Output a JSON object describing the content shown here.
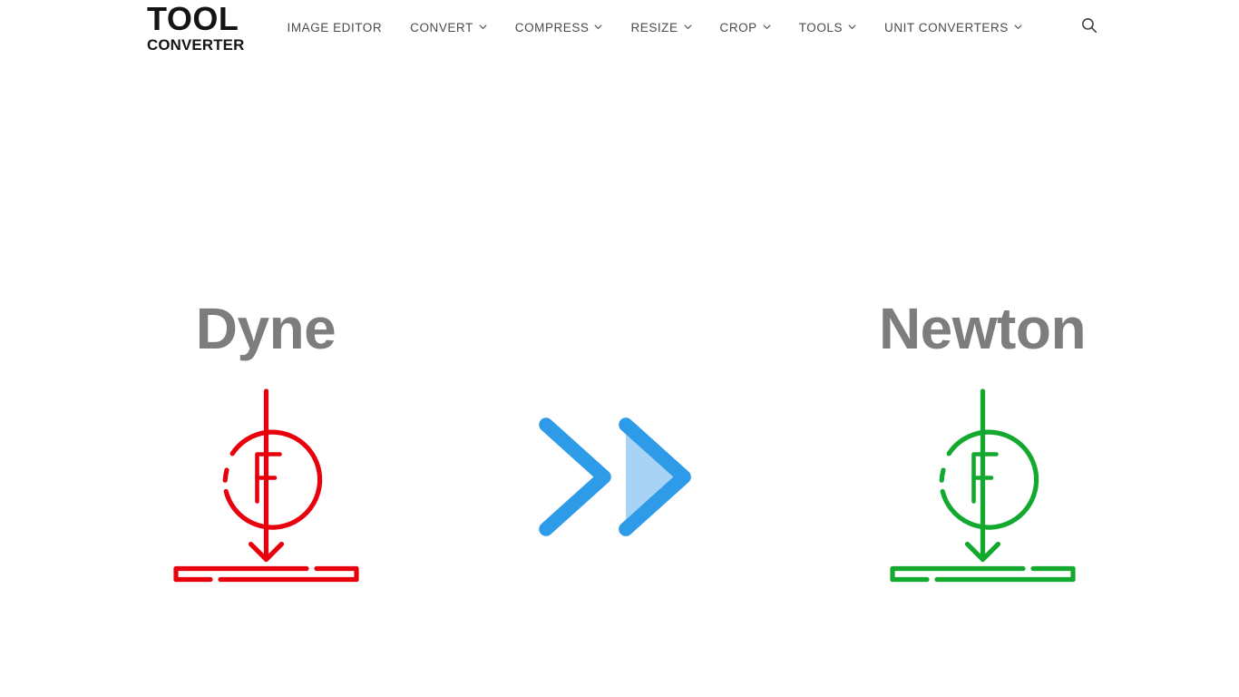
{
  "site": {
    "logo_top": "TOOL",
    "logo_bottom": "CONVERTER"
  },
  "nav": {
    "items": [
      {
        "label": "IMAGE EDITOR",
        "has_dropdown": false
      },
      {
        "label": "CONVERT",
        "has_dropdown": true
      },
      {
        "label": "COMPRESS",
        "has_dropdown": true
      },
      {
        "label": "RESIZE",
        "has_dropdown": true
      },
      {
        "label": "CROP",
        "has_dropdown": true
      },
      {
        "label": "TOOLS",
        "has_dropdown": true
      },
      {
        "label": "UNIT CONVERTERS",
        "has_dropdown": true
      }
    ],
    "search_icon": "search-icon"
  },
  "conversion": {
    "from": {
      "title": "Dyne",
      "symbol_letter": "F",
      "color": "#e8000d",
      "icon": "force-on-surface-icon"
    },
    "to": {
      "title": "Newton",
      "symbol_letter": "F",
      "color": "#12a92e",
      "icon": "force-on-surface-icon"
    },
    "arrow": {
      "icon": "double-chevron-right-icon",
      "stroke_color": "#2e9be8",
      "fill_color": "#a8d3f5"
    }
  },
  "colors": {
    "heading_gray": "#7d7d7d",
    "nav_text": "#4a4a4a",
    "logo_black": "#141414",
    "background": "#ffffff"
  }
}
